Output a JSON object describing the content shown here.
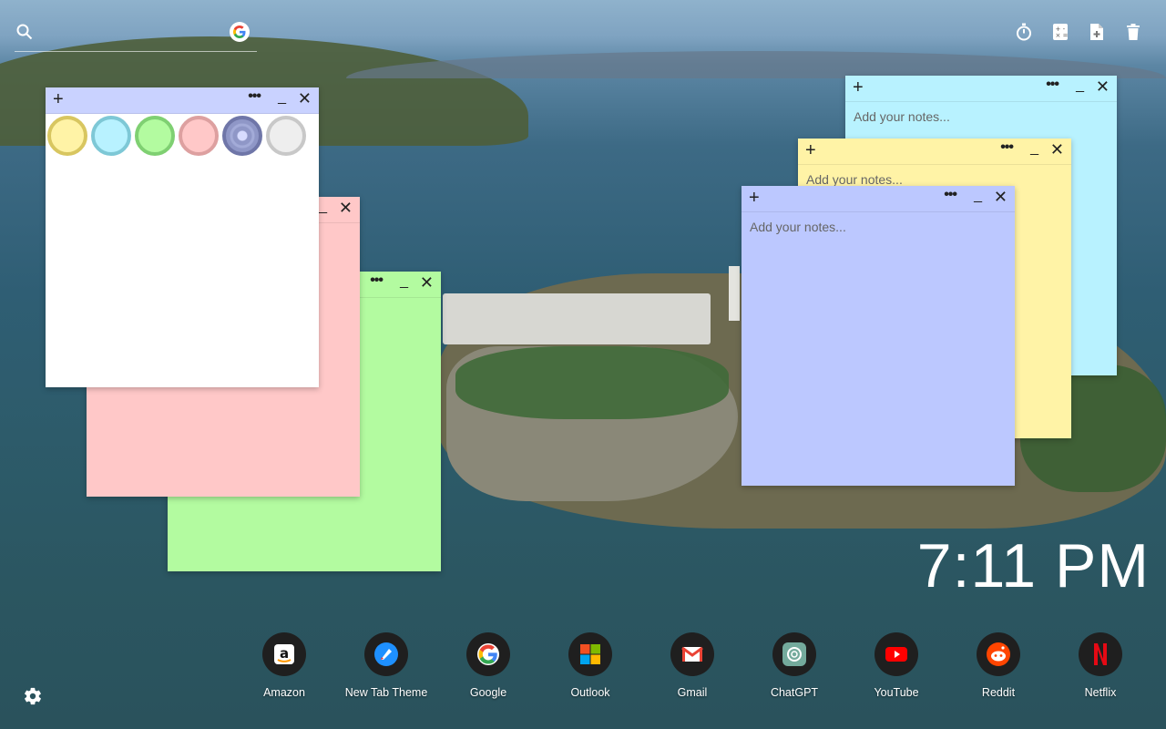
{
  "search": {
    "placeholder": "",
    "icon": "search-icon",
    "engine_icon": "google-icon"
  },
  "tools": [
    {
      "name": "timer-icon"
    },
    {
      "name": "calculator-icon"
    },
    {
      "name": "new-note-icon"
    },
    {
      "name": "trash-icon"
    }
  ],
  "notes": {
    "palette_note": {
      "bg": "#ffffff",
      "bar": "#c9d2ff"
    },
    "pink": {
      "bg": "#ffc8c8"
    },
    "green": {
      "bg": "#b3fba0"
    },
    "cyan": {
      "bg": "#b8f2ff",
      "placeholder": "Add your notes..."
    },
    "yellow": {
      "bg": "#fff3a6",
      "placeholder": "Add your notes..."
    },
    "blue": {
      "bg": "#bcc8ff",
      "placeholder": "Add your notes..."
    },
    "controls": {
      "add": "+",
      "more": "•••",
      "minimize": "_",
      "close": "✕"
    }
  },
  "palette": [
    {
      "name": "yellow",
      "fill": "#fff3a6",
      "ring": "#d8c660"
    },
    {
      "name": "cyan",
      "fill": "#b8f2ff",
      "ring": "#7ec8d6"
    },
    {
      "name": "green",
      "fill": "#b3fba0",
      "ring": "#7fd072"
    },
    {
      "name": "pink",
      "fill": "#ffc8c8",
      "ring": "#dda0a0"
    },
    {
      "name": "blue",
      "fill": "#8f97c7",
      "ring": "#6f76a8",
      "selected": true
    },
    {
      "name": "gray",
      "fill": "#eeeeee",
      "ring": "#c8c8c8"
    }
  ],
  "clock": {
    "time": "7:11 PM"
  },
  "dock": [
    {
      "label": "Amazon",
      "icon": "amazon-icon"
    },
    {
      "label": "New Tab Theme",
      "icon": "new-tab-theme-icon"
    },
    {
      "label": "Google",
      "icon": "google-icon"
    },
    {
      "label": "Outlook",
      "icon": "outlook-icon"
    },
    {
      "label": "Gmail",
      "icon": "gmail-icon"
    },
    {
      "label": "ChatGPT",
      "icon": "chatgpt-icon"
    },
    {
      "label": "YouTube",
      "icon": "youtube-icon"
    },
    {
      "label": "Reddit",
      "icon": "reddit-icon"
    },
    {
      "label": "Netflix",
      "icon": "netflix-icon"
    }
  ],
  "settings": {
    "icon": "gear-icon"
  }
}
